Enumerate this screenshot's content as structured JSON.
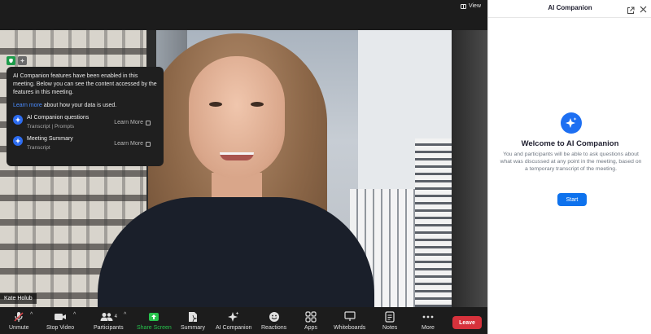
{
  "topbar": {
    "view_label": "View"
  },
  "video": {
    "participant_name": "Kate Holub"
  },
  "ai_popup": {
    "intro": "AI Companion features have been enabled in this meeting. Below you can see the content accessed by the features in this meeting.",
    "learn_link": "Learn more",
    "learn_rest": " about how your data is used.",
    "features": [
      {
        "title": "AI Companion questions",
        "sub": "Transcript | Prompts",
        "learn_more": "Learn More"
      },
      {
        "title": "Meeting Summary",
        "sub": "Transcript",
        "learn_more": "Learn More"
      }
    ]
  },
  "toolbar": {
    "unmute": "Unmute",
    "stop_video": "Stop Video",
    "participants": "Participants",
    "participants_count": "4",
    "share_screen": "Share Screen",
    "summary": "Summary",
    "ai_companion": "AI Companion",
    "reactions": "Reactions",
    "apps": "Apps",
    "whiteboards": "Whiteboards",
    "notes": "Notes",
    "more": "More",
    "leave": "Leave"
  },
  "panel": {
    "title": "AI Companion",
    "welcome": "Welcome to AI Companion",
    "description": "You and participants will be able to ask questions about what was discussed at any point in the meeting, based on a temporary transcript of the meeting.",
    "start": "Start"
  },
  "colors": {
    "accent": "#0e72ed",
    "leave": "#d7323c",
    "share_green": "#27c24c",
    "shield_green": "#1d9b4a"
  }
}
